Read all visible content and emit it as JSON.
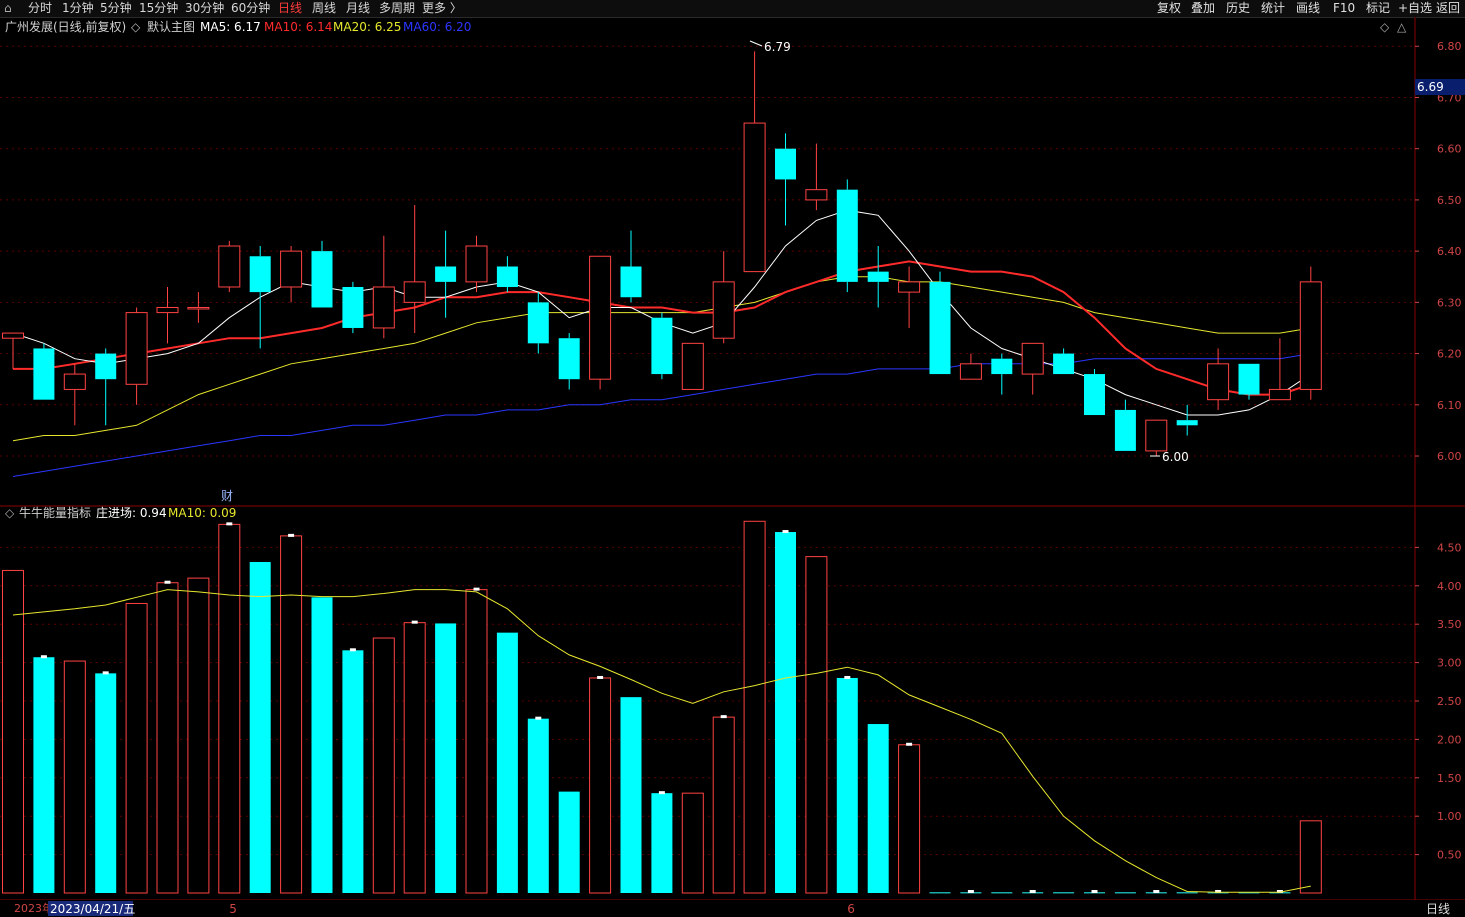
{
  "toolbar": {
    "left_icon": "⌂",
    "periods": [
      "分时",
      "1分钟",
      "5分钟",
      "15分钟",
      "30分钟",
      "60分钟",
      "日线",
      "周线",
      "月线",
      "多周期",
      "更多 〉"
    ],
    "active_period": "日线",
    "right_buttons": [
      "复权",
      "叠加",
      "历史",
      "统计",
      "画线",
      "F10",
      "标记",
      "+自选",
      "返回"
    ]
  },
  "main_chart": {
    "stock_title": "广州发展(日线,前复权)",
    "template": "默认主图",
    "ma_legend": [
      {
        "label": "MA5: 6.17",
        "color": "#ffffff"
      },
      {
        "label": "MA10: 6.14",
        "color": "#ff2b2b"
      },
      {
        "label": "MA20: 6.25",
        "color": "#e6e62e"
      },
      {
        "label": "MA60: 6.20",
        "color": "#2b36ff"
      }
    ],
    "high_marker": "6.79",
    "low_marker": "6.00",
    "current_price_tag": "6.69",
    "event_marker": "财"
  },
  "sub_chart": {
    "indicator_name": "牛牛能量指标",
    "legend": [
      {
        "label": "庄进场: 0.94",
        "color": "#ffffff"
      },
      {
        "label": "MA10: 0.09",
        "color": "#e6e62e"
      }
    ]
  },
  "time_axis": {
    "year_label": "2023年",
    "cursor_date": "2023/04/21/五",
    "month_labels": [
      {
        "label": "5",
        "index": 7
      },
      {
        "label": "6",
        "index": 27
      }
    ],
    "period_tab": "日线"
  },
  "colors": {
    "up": "#ff4343",
    "down": "#00ffff",
    "ma5": "#ffffff",
    "ma10": "#ff2b2b",
    "ma20": "#e6e62e",
    "ma60": "#2b36ff",
    "grid": "#5a0000",
    "axis_text": "#d04545"
  },
  "chart_data": [
    {
      "type": "candlestick",
      "title": "广州发展(日线,前复权)",
      "y_ticks": [
        6.8,
        6.7,
        6.6,
        6.5,
        6.4,
        6.3,
        6.2,
        6.1,
        6.0
      ],
      "ylim": [
        5.92,
        6.82
      ],
      "candles": [
        {
          "o": 6.23,
          "h": 6.24,
          "l": 6.17,
          "c": 6.24
        },
        {
          "o": 6.21,
          "h": 6.22,
          "l": 6.11,
          "c": 6.11
        },
        {
          "o": 6.13,
          "h": 6.18,
          "l": 6.06,
          "c": 6.16
        },
        {
          "o": 6.2,
          "h": 6.21,
          "l": 6.06,
          "c": 6.15
        },
        {
          "o": 6.14,
          "h": 6.29,
          "l": 6.1,
          "c": 6.28
        },
        {
          "o": 6.28,
          "h": 6.33,
          "l": 6.22,
          "c": 6.29
        },
        {
          "o": 6.29,
          "h": 6.32,
          "l": 6.26,
          "c": 6.29
        },
        {
          "o": 6.33,
          "h": 6.42,
          "l": 6.32,
          "c": 6.41
        },
        {
          "o": 6.39,
          "h": 6.41,
          "l": 6.21,
          "c": 6.32
        },
        {
          "o": 6.33,
          "h": 6.41,
          "l": 6.3,
          "c": 6.4
        },
        {
          "o": 6.4,
          "h": 6.42,
          "l": 6.29,
          "c": 6.29
        },
        {
          "o": 6.33,
          "h": 6.34,
          "l": 6.24,
          "c": 6.25
        },
        {
          "o": 6.25,
          "h": 6.43,
          "l": 6.23,
          "c": 6.33
        },
        {
          "o": 6.3,
          "h": 6.49,
          "l": 6.24,
          "c": 6.34
        },
        {
          "o": 6.37,
          "h": 6.44,
          "l": 6.27,
          "c": 6.34
        },
        {
          "o": 6.34,
          "h": 6.43,
          "l": 6.32,
          "c": 6.41
        },
        {
          "o": 6.37,
          "h": 6.39,
          "l": 6.32,
          "c": 6.33
        },
        {
          "o": 6.3,
          "h": 6.32,
          "l": 6.2,
          "c": 6.22
        },
        {
          "o": 6.23,
          "h": 6.24,
          "l": 6.13,
          "c": 6.15
        },
        {
          "o": 6.15,
          "h": 6.39,
          "l": 6.13,
          "c": 6.39
        },
        {
          "o": 6.37,
          "h": 6.44,
          "l": 6.3,
          "c": 6.31
        },
        {
          "o": 6.27,
          "h": 6.28,
          "l": 6.15,
          "c": 6.16
        },
        {
          "o": 6.13,
          "h": 6.22,
          "l": 6.13,
          "c": 6.22
        },
        {
          "o": 6.23,
          "h": 6.4,
          "l": 6.22,
          "c": 6.34
        },
        {
          "o": 6.36,
          "h": 6.79,
          "l": 6.36,
          "c": 6.65
        },
        {
          "o": 6.6,
          "h": 6.63,
          "l": 6.45,
          "c": 6.54
        },
        {
          "o": 6.5,
          "h": 6.61,
          "l": 6.48,
          "c": 6.52
        },
        {
          "o": 6.52,
          "h": 6.54,
          "l": 6.32,
          "c": 6.34
        },
        {
          "o": 6.36,
          "h": 6.41,
          "l": 6.29,
          "c": 6.34
        },
        {
          "o": 6.32,
          "h": 6.37,
          "l": 6.25,
          "c": 6.34
        },
        {
          "o": 6.34,
          "h": 6.36,
          "l": 6.16,
          "c": 6.16
        },
        {
          "o": 6.15,
          "h": 6.2,
          "l": 6.15,
          "c": 6.18
        },
        {
          "o": 6.19,
          "h": 6.2,
          "l": 6.12,
          "c": 6.16
        },
        {
          "o": 6.16,
          "h": 6.22,
          "l": 6.12,
          "c": 6.22
        },
        {
          "o": 6.2,
          "h": 6.21,
          "l": 6.16,
          "c": 6.16
        },
        {
          "o": 6.16,
          "h": 6.17,
          "l": 6.08,
          "c": 6.08
        },
        {
          "o": 6.09,
          "h": 6.11,
          "l": 6.01,
          "c": 6.01
        },
        {
          "o": 6.01,
          "h": 6.07,
          "l": 6.0,
          "c": 6.07
        },
        {
          "o": 6.07,
          "h": 6.1,
          "l": 6.04,
          "c": 6.06
        },
        {
          "o": 6.11,
          "h": 6.21,
          "l": 6.09,
          "c": 6.18
        },
        {
          "o": 6.18,
          "h": 6.18,
          "l": 6.11,
          "c": 6.12
        },
        {
          "o": 6.11,
          "h": 6.23,
          "l": 6.11,
          "c": 6.13
        },
        {
          "o": 6.13,
          "h": 6.37,
          "l": 6.11,
          "c": 6.34
        }
      ],
      "ma5": [
        6.24,
        6.22,
        6.19,
        6.18,
        6.19,
        6.2,
        6.22,
        6.27,
        6.31,
        6.34,
        6.33,
        6.32,
        6.33,
        6.31,
        6.31,
        6.33,
        6.34,
        6.32,
        6.27,
        6.29,
        6.29,
        6.26,
        6.24,
        6.26,
        6.33,
        6.41,
        6.46,
        6.48,
        6.47,
        6.4,
        6.32,
        6.25,
        6.21,
        6.19,
        6.17,
        6.15,
        6.12,
        6.1,
        6.08,
        6.08,
        6.09,
        6.12,
        6.16
      ],
      "ma10": [
        6.17,
        6.17,
        6.18,
        6.19,
        6.2,
        6.21,
        6.22,
        6.23,
        6.23,
        6.24,
        6.25,
        6.27,
        6.28,
        6.29,
        6.31,
        6.31,
        6.32,
        6.32,
        6.31,
        6.3,
        6.29,
        6.29,
        6.28,
        6.28,
        6.29,
        6.32,
        6.34,
        6.36,
        6.37,
        6.38,
        6.37,
        6.36,
        6.36,
        6.35,
        6.32,
        6.27,
        6.21,
        6.17,
        6.15,
        6.13,
        6.12,
        6.12,
        6.14
      ],
      "ma20": [
        6.03,
        6.04,
        6.04,
        6.05,
        6.06,
        6.09,
        6.12,
        6.14,
        6.16,
        6.18,
        6.19,
        6.2,
        6.21,
        6.22,
        6.24,
        6.26,
        6.27,
        6.28,
        6.28,
        6.28,
        6.28,
        6.28,
        6.28,
        6.29,
        6.3,
        6.32,
        6.34,
        6.35,
        6.35,
        6.34,
        6.34,
        6.33,
        6.32,
        6.31,
        6.3,
        6.28,
        6.27,
        6.26,
        6.25,
        6.24,
        6.24,
        6.24,
        6.25
      ],
      "ma60": [
        5.96,
        5.97,
        5.98,
        5.99,
        6.0,
        6.01,
        6.02,
        6.03,
        6.04,
        6.04,
        6.05,
        6.06,
        6.06,
        6.07,
        6.08,
        6.08,
        6.09,
        6.09,
        6.1,
        6.1,
        6.11,
        6.11,
        6.12,
        6.13,
        6.14,
        6.15,
        6.16,
        6.16,
        6.17,
        6.17,
        6.17,
        6.18,
        6.18,
        6.18,
        6.18,
        6.19,
        6.19,
        6.19,
        6.19,
        6.19,
        6.19,
        6.19,
        6.2
      ]
    },
    {
      "type": "bar",
      "title": "牛牛能量指标",
      "y_ticks": [
        4.5,
        4.0,
        3.5,
        3.0,
        2.5,
        2.0,
        1.5,
        1.0,
        0.5
      ],
      "ylim": [
        0,
        5.0
      ],
      "series": [
        {
          "name": "庄进场",
          "values": [
            4.2,
            3.07,
            3.02,
            2.86,
            3.77,
            4.04,
            4.1,
            4.8,
            4.31,
            4.65,
            3.85,
            3.16,
            3.32,
            3.52,
            3.51,
            3.95,
            3.39,
            2.27,
            1.32,
            2.8,
            2.55,
            1.3,
            1.3,
            2.29,
            4.84,
            4.7,
            4.38,
            2.8,
            2.2,
            1.93,
            0,
            0,
            0,
            0,
            0,
            0,
            0,
            0,
            0,
            0,
            0,
            0,
            0.94
          ],
          "up": [
            1,
            0,
            1,
            0,
            1,
            1,
            1,
            1,
            0,
            1,
            0,
            0,
            1,
            1,
            0,
            1,
            0,
            0,
            0,
            1,
            0,
            0,
            1,
            1,
            1,
            0,
            1,
            0,
            0,
            1,
            0,
            0,
            0,
            0,
            0,
            0,
            0,
            0,
            0,
            0,
            0,
            0,
            1
          ]
        },
        {
          "name": "MA10",
          "values": [
            3.62,
            3.66,
            3.7,
            3.75,
            3.85,
            3.95,
            3.92,
            3.88,
            3.86,
            3.88,
            3.86,
            3.86,
            3.9,
            3.95,
            3.95,
            3.92,
            3.7,
            3.35,
            3.1,
            2.95,
            2.78,
            2.6,
            2.47,
            2.62,
            2.7,
            2.8,
            2.86,
            2.94,
            2.84,
            2.58,
            2.42,
            2.26,
            2.08,
            1.52,
            1.0,
            0.68,
            0.42,
            0.2,
            0.02,
            0.01,
            0.01,
            0.01,
            0.09
          ]
        }
      ]
    }
  ]
}
